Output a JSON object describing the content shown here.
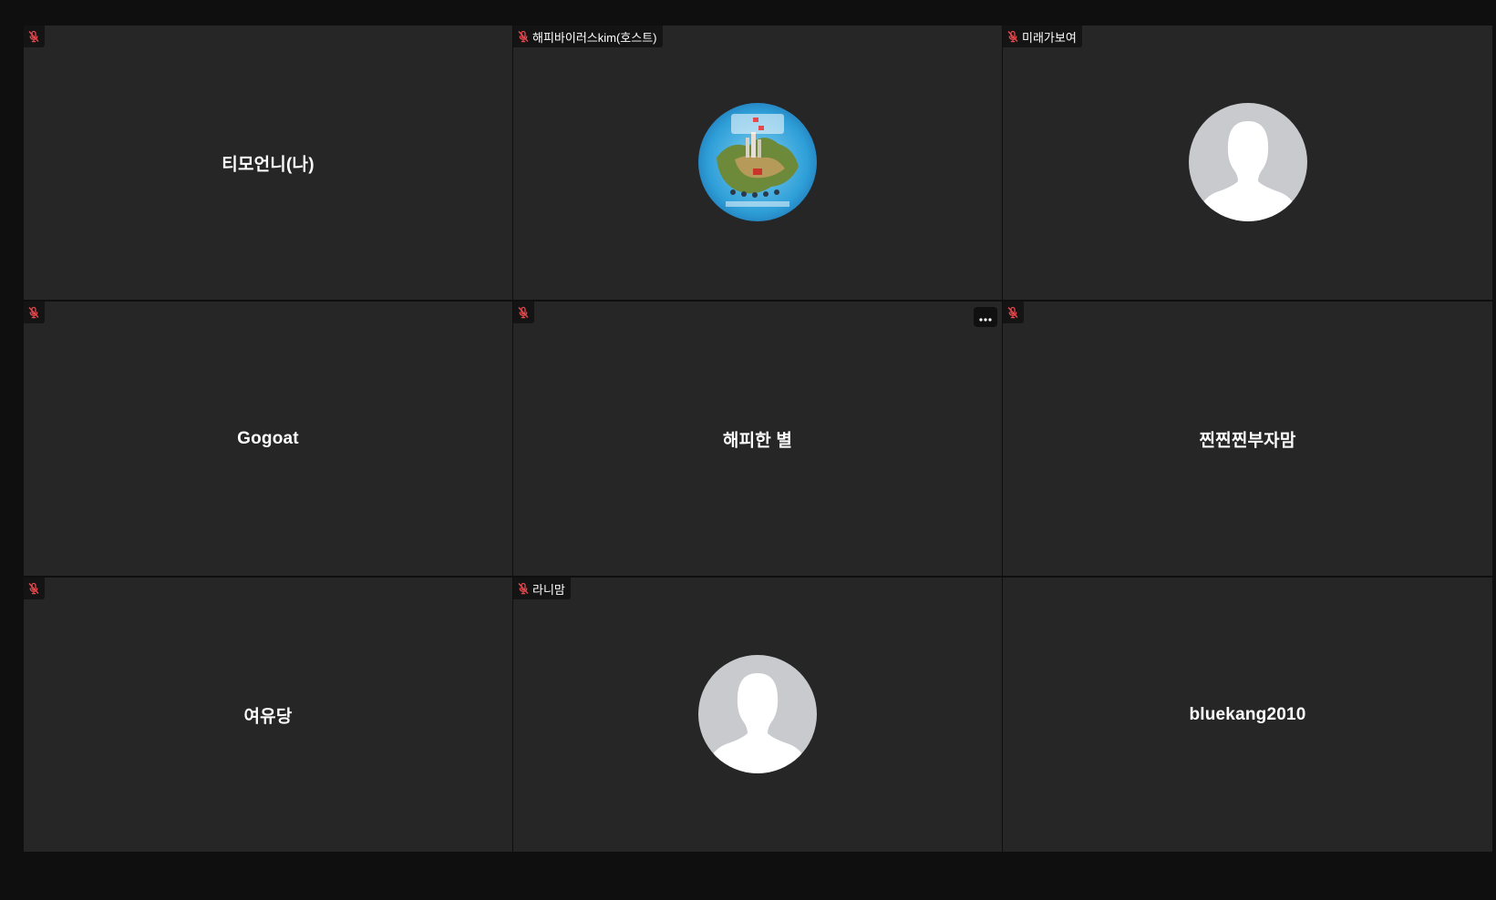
{
  "participants": [
    {
      "display_name": "티모언니(나)",
      "tag_label": "",
      "muted": true,
      "avatar": "none",
      "has_more_button": false
    },
    {
      "display_name": "",
      "tag_label": "해피바이러스kim(호스트)",
      "muted": true,
      "avatar": "photo-map-illustration",
      "has_more_button": false
    },
    {
      "display_name": "",
      "tag_label": "미래가보여",
      "muted": true,
      "avatar": "default-person",
      "has_more_button": false
    },
    {
      "display_name": "Gogoat",
      "tag_label": "",
      "muted": true,
      "avatar": "none",
      "has_more_button": false
    },
    {
      "display_name": "해피한 별",
      "tag_label": "",
      "muted": true,
      "avatar": "none",
      "has_more_button": true
    },
    {
      "display_name": "찐찐찐부자맘",
      "tag_label": "",
      "muted": true,
      "avatar": "none",
      "has_more_button": false
    },
    {
      "display_name": "여유당",
      "tag_label": "",
      "muted": true,
      "avatar": "none",
      "has_more_button": false
    },
    {
      "display_name": "",
      "tag_label": "라니맘",
      "muted": true,
      "avatar": "default-person",
      "has_more_button": false
    },
    {
      "display_name": "bluekang2010",
      "tag_label": "",
      "muted": false,
      "avatar": "none",
      "has_more_button": false
    }
  ],
  "icons": {
    "muted": "mic-muted-icon",
    "more": "more-options-icon"
  },
  "colors": {
    "background": "#0f0f0f",
    "tile": "#262626",
    "tag_background": "#141414",
    "muted_icon": "#e5484d",
    "avatar_placeholder": "#c8cacd",
    "text": "#ffffff"
  }
}
